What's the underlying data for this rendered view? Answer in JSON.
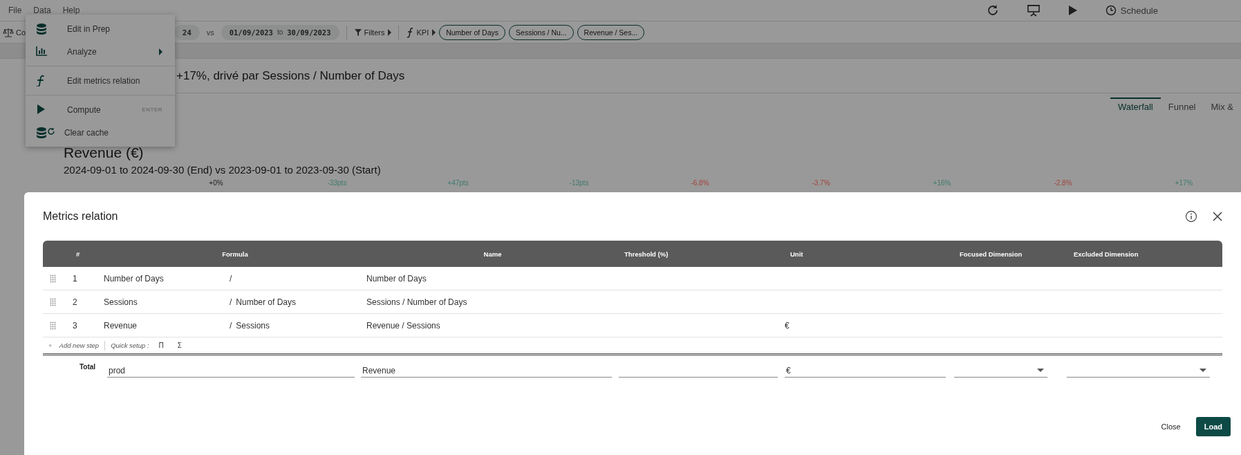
{
  "menu_bar": {
    "items": [
      {
        "label": "File"
      },
      {
        "label": "Data"
      },
      {
        "label": "Help"
      }
    ]
  },
  "top_actions": {
    "schedule": "Schedule"
  },
  "toolbar": {
    "compare_label": "Co",
    "period_end": "24",
    "vs": "vs",
    "period_start": {
      "from": "01/09/2023",
      "to_word": "to",
      "to": "30/09/2023"
    },
    "filters": "Filters",
    "kpi": "KPI",
    "kpi_pills": [
      "Number of Days",
      "Sessions / Nu...",
      "Revenue / Ses..."
    ]
  },
  "data_menu": {
    "items": [
      {
        "kind": "item",
        "label": "Edit in Prep"
      },
      {
        "kind": "submenu",
        "label": "Analyze"
      },
      {
        "kind": "divider"
      },
      {
        "kind": "item",
        "label": "Edit metrics relation"
      },
      {
        "kind": "divider"
      },
      {
        "kind": "shortcut",
        "label": "Compute",
        "shortcut": "ENTER"
      },
      {
        "kind": "item",
        "label": "Clear cache"
      }
    ]
  },
  "headline": "+17%, drivé par Sessions / Number of Days",
  "view_tabs": [
    {
      "label": "Waterfall",
      "selected": true
    },
    {
      "label": "Funnel",
      "selected": false
    },
    {
      "label": "Mix &",
      "selected": false
    }
  ],
  "chart": {
    "title": "Revenue (€)",
    "subtitle": "2024-09-01 to 2024-09-30 (End) vs 2023-09-01 to 2023-09-30 (Start)",
    "deltas": [
      {
        "label": "+0%",
        "color": "#222222"
      },
      {
        "label": "-33pts",
        "color": "#3f7a6c"
      },
      {
        "label": "+47pts",
        "color": "#3f7a6c"
      },
      {
        "label": "-13pts",
        "color": "#3f7a6c"
      },
      {
        "label": "-6.8%",
        "color": "#a3433a"
      },
      {
        "label": "-3.7%",
        "color": "#a3433a"
      },
      {
        "label": "+16%",
        "color": "#3f7a6c"
      },
      {
        "label": "-2.8%",
        "color": "#a3433a"
      },
      {
        "label": "+17%",
        "color": "#3f7a6c"
      }
    ]
  },
  "modal": {
    "title": "Metrics relation",
    "columns": [
      "#",
      "Formula",
      "Name",
      "Threshold (%)",
      "Unit",
      "Focused Dimension",
      "Excluded Dimension"
    ],
    "rows": [
      {
        "index": "1",
        "formula_left": "Number of Days",
        "operator": "/",
        "name": "Number of Days"
      },
      {
        "index": "2",
        "formula_left": "Sessions",
        "operator": "/",
        "formula_right": "Number of Days",
        "name": "Sessions / Number of Days"
      },
      {
        "index": "3",
        "formula_left": "Revenue",
        "operator": "/",
        "formula_right": "Sessions",
        "name": "Revenue / Sessions",
        "unit": "€"
      }
    ],
    "add_step": {
      "plus": "+",
      "label": "Add new step"
    },
    "quick_setup": {
      "label": "Quick setup :",
      "buttons": [
        "Π",
        "Σ"
      ]
    },
    "total": {
      "label": "Total",
      "formula": "prod",
      "name": "Revenue",
      "unit": "€"
    },
    "buttons": {
      "close": "Close",
      "load": "Load"
    }
  }
}
